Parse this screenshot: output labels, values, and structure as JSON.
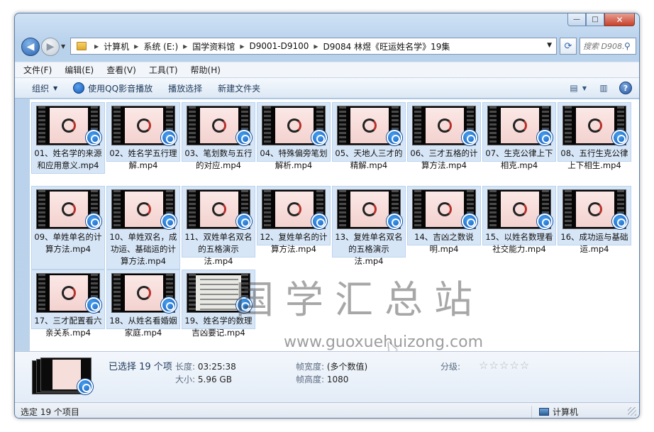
{
  "window": {
    "caption_buttons": {
      "minimize": "—",
      "maximize": "□",
      "close": "✕"
    }
  },
  "nav": {
    "breadcrumbs": [
      "计算机",
      "系统 (E:)",
      "国学资料馆",
      "D9001-D9100",
      "D9084 林煜《旺运姓名学》19集"
    ],
    "search_placeholder": "搜索 D908...",
    "icons": {
      "back": "back-arrow-icon",
      "forward": "forward-arrow-icon",
      "refresh": "refresh-icon",
      "search": "search-icon"
    }
  },
  "menu": [
    "文件(F)",
    "编辑(E)",
    "查看(V)",
    "工具(T)",
    "帮助(H)"
  ],
  "toolbar": {
    "organize": "组织",
    "play_qq": "使用QQ影音播放",
    "play_selection": "播放选择",
    "new_folder": "新建文件夹"
  },
  "files": [
    {
      "name": "01、姓名学的来源和应用意义.mp4",
      "kind": "video"
    },
    {
      "name": "02、姓名学五行理解.mp4",
      "kind": "video"
    },
    {
      "name": "03、笔划数与五行的对应.mp4",
      "kind": "video"
    },
    {
      "name": "04、特殊偏旁笔划解析.mp4",
      "kind": "video"
    },
    {
      "name": "05、天地人三才的精解.mp4",
      "kind": "video"
    },
    {
      "name": "06、三才五格的计算方法.mp4",
      "kind": "video"
    },
    {
      "name": "07、生克公律上下相克.mp4",
      "kind": "video"
    },
    {
      "name": "08、五行生克公律上下相生.mp4",
      "kind": "video"
    },
    {
      "name": "09、单姓单名的计算方法.mp4",
      "kind": "video"
    },
    {
      "name": "10、单姓双名，成功运、基础运的计算方法.mp4",
      "kind": "video"
    },
    {
      "name": "11、双姓单名双名的五格演示法.mp4",
      "kind": "video"
    },
    {
      "name": "12、复姓单名的计算方法.mp4",
      "kind": "video"
    },
    {
      "name": "13、复姓单名双名的五格演示法.mp4",
      "kind": "video"
    },
    {
      "name": "14、吉凶之数说明.mp4",
      "kind": "video"
    },
    {
      "name": "15、以姓名数理看社交能力.mp4",
      "kind": "video"
    },
    {
      "name": "16、成功运与基础运.mp4",
      "kind": "video"
    },
    {
      "name": "17、三才配置看六亲关系.mp4",
      "kind": "video"
    },
    {
      "name": "18、从姓名看婚姻家庭.mp4",
      "kind": "video"
    },
    {
      "name": "19、姓名学的数理吉凶要记.mp4",
      "kind": "document"
    }
  ],
  "watermark": {
    "title": "国学汇总站",
    "url": "www.guoxuehuizong.com"
  },
  "details": {
    "selected": "已选择 19 个项",
    "length_label": "长度:",
    "length_value": "03:25:38",
    "size_label": "大小:",
    "size_value": "5.96 GB",
    "frame_width_label": "帧宽度:",
    "frame_width_value": "(多个数值)",
    "frame_height_label": "帧高度:",
    "frame_height_value": "1080",
    "rating_label": "分级:",
    "rating_stars": "☆☆☆☆☆"
  },
  "status": {
    "left": "选定 19 个项目",
    "right": "计算机"
  }
}
